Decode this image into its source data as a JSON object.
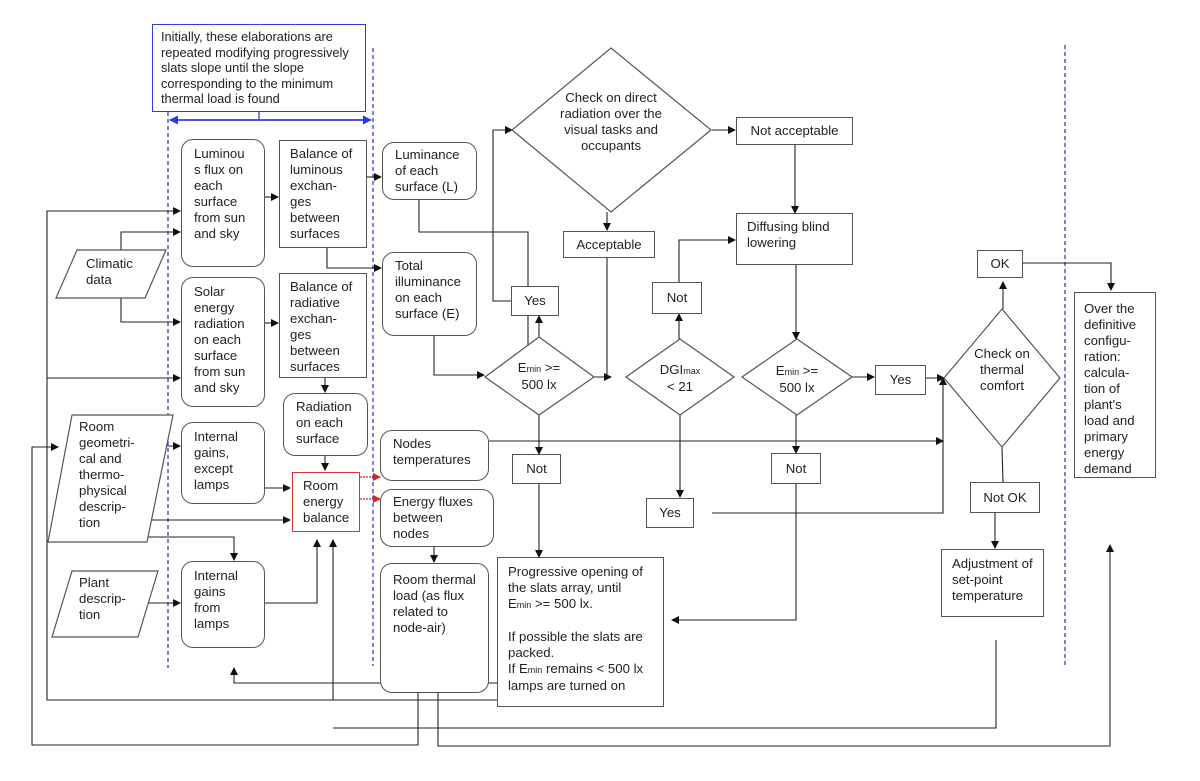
{
  "note": {
    "text": "Initially, these elaborations are repeated modifying progressively slats slope until the slope corresponding to the minimum thermal load is found"
  },
  "inputs": {
    "climatic": "Climatic data",
    "room": "Room geometri-cal and thermo-physical descrip-tion",
    "plant": "Plant descrip-tion"
  },
  "process": {
    "luminous_flux": "Luminou s flux on each surface from sun and sky",
    "solar_energy": "Solar energy radiation on each surface from sun and sky",
    "internal_gains_except": "Internal gains, except lamps",
    "internal_gains_lamps": "Internal gains from lamps",
    "balance_luminous": "Balance of luminous exchan-ges between surfaces",
    "balance_radiative": "Balance of radiative exchan-ges between surfaces",
    "radiation_surface": "Radiation on each surface",
    "room_energy_balance": "Room energy balance",
    "luminance": "Luminance of each surface (L)",
    "total_illuminance": "Total illuminance on each surface (E)",
    "nodes_temperatures": "Nodes temperatures",
    "energy_fluxes": "Energy fluxes between nodes",
    "room_thermal_load": "Room thermal load (as flux related to node-air)",
    "progressive_opening": {
      "line1": "Progressive opening of the slats array, until",
      "line2_pre": "E",
      "line2_sub": "min",
      "line2_post": " >= 500 lx.",
      "line3": "If possible the slats are packed.",
      "line4_pre": "If E",
      "line4_sub": "min",
      "line4_post": " remains < 500 lx",
      "line5": "lamps are turned on"
    },
    "diffusing_blind": "Diffusing blind lowering",
    "adjustment_setpoint": "Adjustment of set-point temperature",
    "final_calc": "Over the definitive configu-ration: calcula-tion of plant's load and primary energy demand"
  },
  "decisions": {
    "direct_radiation": "Check on direct radiation over the visual tasks and occupants",
    "emin_1": {
      "pre": "E",
      "sub": "min",
      "post": " >=",
      "line2": "500 lx"
    },
    "dgi": {
      "pre": "DGI",
      "sub": "max",
      "line2": "< 21"
    },
    "emin_2": {
      "pre": "E",
      "sub": "min",
      "post": " >=",
      "line2": "500 lx"
    },
    "thermal_comfort": "Check on thermal comfort"
  },
  "outcomes": {
    "acceptable": "Acceptable",
    "not_acceptable": "Not acceptable",
    "yes_1": "Yes",
    "not_1": "Not",
    "not_dgi": "Not",
    "yes_dgi": "Yes",
    "not_2": "Not",
    "yes_2": "Yes",
    "ok": "OK",
    "not_ok": "Not OK"
  },
  "colors": {
    "line": "#222222",
    "node_border": "#555555",
    "highlight": "#e03030",
    "guide": "#2a3fd6"
  }
}
